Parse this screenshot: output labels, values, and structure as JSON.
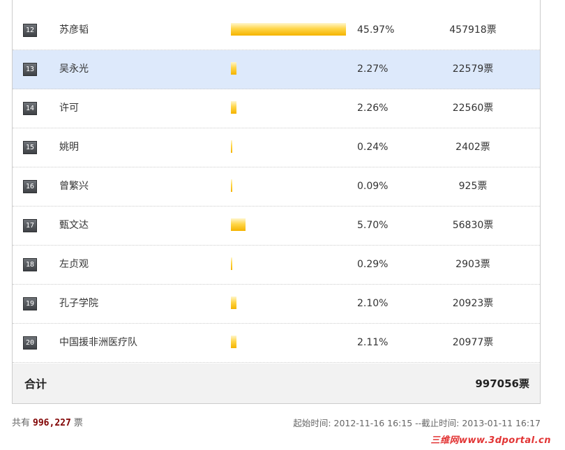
{
  "poll": {
    "rows": [
      {
        "rank": "12",
        "name": "苏彦韬",
        "percent": "45.97%",
        "votes": "457918票",
        "share": 45.97,
        "highlighted": false
      },
      {
        "rank": "13",
        "name": "吴永光",
        "percent": "2.27%",
        "votes": "22579票",
        "share": 2.27,
        "highlighted": true
      },
      {
        "rank": "14",
        "name": "许可",
        "percent": "2.26%",
        "votes": "22560票",
        "share": 2.26,
        "highlighted": false
      },
      {
        "rank": "15",
        "name": "姚明",
        "percent": "0.24%",
        "votes": "2402票",
        "share": 0.24,
        "highlighted": false
      },
      {
        "rank": "16",
        "name": "曾繁兴",
        "percent": "0.09%",
        "votes": "925票",
        "share": 0.09,
        "highlighted": false
      },
      {
        "rank": "17",
        "name": "甄文达",
        "percent": "5.70%",
        "votes": "56830票",
        "share": 5.7,
        "highlighted": false
      },
      {
        "rank": "18",
        "name": "左贞观",
        "percent": "0.29%",
        "votes": "2903票",
        "share": 0.29,
        "highlighted": false
      },
      {
        "rank": "19",
        "name": "孔子学院",
        "percent": "2.10%",
        "votes": "20923票",
        "share": 2.1,
        "highlighted": false
      },
      {
        "rank": "20",
        "name": "中国援非洲医疗队",
        "percent": "2.11%",
        "votes": "20977票",
        "share": 2.11,
        "highlighted": false
      }
    ],
    "total_label": "合计",
    "total_value": "997056票"
  },
  "footer": {
    "total_prefix": "共有",
    "total_count": "996,227",
    "total_suffix": "票",
    "time_range": "起始时间: 2012-11-16 16:15 --截止时间: 2013-01-11 16:17"
  },
  "watermark": "三维网www.3dportal.cn",
  "colors": {
    "bar": "#ffd649",
    "highlight_row": "#dde9fb",
    "count_accent": "#800000",
    "watermark": "#e23434"
  }
}
